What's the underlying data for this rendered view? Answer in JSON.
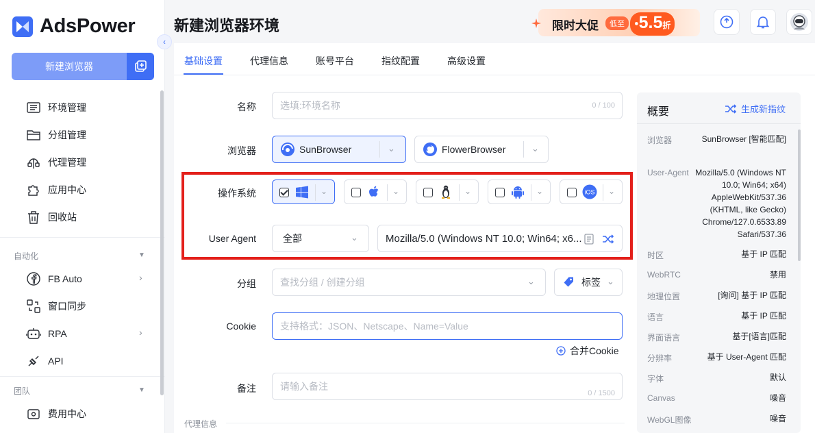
{
  "app": {
    "name": "AdsPower"
  },
  "sidebar": {
    "new_browser_label": "新建浏览器",
    "items": [
      {
        "label": "环境管理",
        "icon": "profile-list-icon"
      },
      {
        "label": "分组管理",
        "icon": "folder-icon"
      },
      {
        "label": "代理管理",
        "icon": "proxy-icon"
      },
      {
        "label": "应用中心",
        "icon": "puzzle-icon"
      },
      {
        "label": "回收站",
        "icon": "trash-icon"
      }
    ],
    "automation_label": "自动化",
    "automation_items": [
      {
        "label": "FB Auto",
        "icon": "facebook-icon"
      },
      {
        "label": "窗口同步",
        "icon": "sync-windows-icon"
      },
      {
        "label": "RPA",
        "icon": "robot-icon"
      },
      {
        "label": "API",
        "icon": "api-icon"
      }
    ],
    "team_label": "团队",
    "team_items": [
      {
        "label": "费用中心",
        "icon": "billing-icon"
      }
    ]
  },
  "header": {
    "title": "新建浏览器环境",
    "promo": {
      "text": "限时大促",
      "tag": "低至",
      "number": "5.5",
      "unit": "折"
    }
  },
  "tabs": [
    "基础设置",
    "代理信息",
    "账号平台",
    "指纹配置",
    "高级设置"
  ],
  "active_tab": "基础设置",
  "form": {
    "name": {
      "label": "名称",
      "placeholder": "选填:环境名称",
      "counter": "0 / 100"
    },
    "browser": {
      "label": "浏览器",
      "options": [
        "SunBrowser",
        "FlowerBrowser"
      ],
      "selected": "SunBrowser"
    },
    "os": {
      "label": "操作系统",
      "options": [
        {
          "icon": "windows-icon",
          "checked": true
        },
        {
          "icon": "apple-icon",
          "checked": false
        },
        {
          "icon": "linux-icon",
          "checked": false
        },
        {
          "icon": "android-icon",
          "checked": false
        },
        {
          "icon": "ios-icon",
          "checked": false
        }
      ]
    },
    "user_agent": {
      "label": "User Agent",
      "scope": "全部",
      "value": "Mozilla/5.0 (Windows NT 10.0; Win64; x6..."
    },
    "group": {
      "label": "分组",
      "placeholder": "查找分组 / 创建分组",
      "tag_label": "标签"
    },
    "cookie": {
      "label": "Cookie",
      "placeholder": "支持格式：JSON、Netscape、Name=Value",
      "merge_label": "合并Cookie"
    },
    "remark": {
      "label": "备注",
      "placeholder": "请输入备注",
      "counter": "0 / 1500"
    },
    "next_section": "代理信息"
  },
  "overview": {
    "title": "概要",
    "generate_label": "生成新指纹",
    "rows": [
      {
        "key": "浏览器",
        "value": "SunBrowser [智能匹配]"
      },
      {
        "key": "User-Agent",
        "value": "Mozilla/5.0 (Windows NT 10.0; Win64; x64) AppleWebKit/537.36 (KHTML, like Gecko) Chrome/127.0.6533.89 Safari/537.36"
      },
      {
        "key": "时区",
        "value": "基于 IP 匹配"
      },
      {
        "key": "WebRTC",
        "value": "禁用"
      },
      {
        "key": "地理位置",
        "value": "[询问] 基于 IP 匹配"
      },
      {
        "key": "语言",
        "value": "基于 IP 匹配"
      },
      {
        "key": "界面语言",
        "value": "基于[语言]匹配"
      },
      {
        "key": "分辨率",
        "value": "基于 User-Agent 匹配"
      },
      {
        "key": "字体",
        "value": "默认"
      },
      {
        "key": "Canvas",
        "value": "噪音"
      },
      {
        "key": "WebGL图像",
        "value": "噪音"
      }
    ]
  },
  "colors": {
    "accent": "#3f6ef5",
    "highlight": "#e3201b",
    "promo": "#ff5a1f"
  }
}
